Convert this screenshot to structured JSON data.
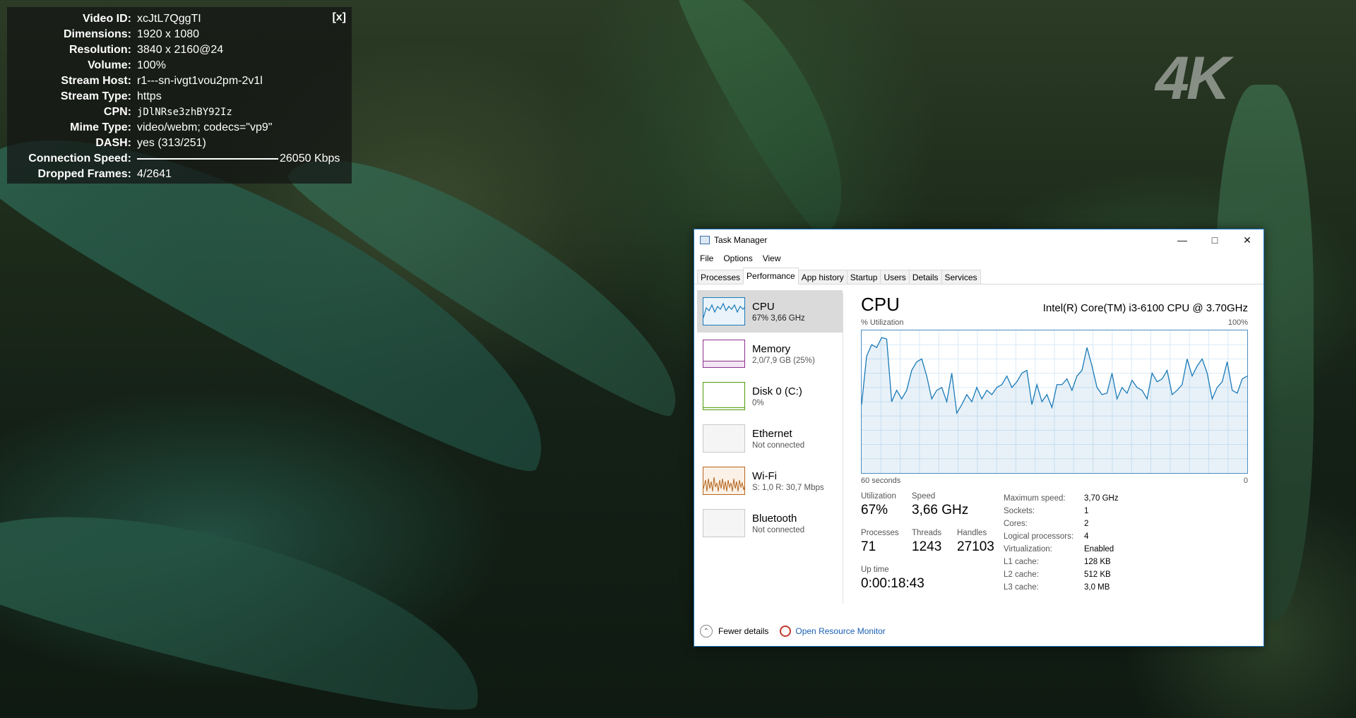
{
  "overlay": {
    "close_label": "[x]",
    "rows": [
      {
        "key": "Video ID:",
        "value": "xcJtL7QggTI"
      },
      {
        "key": "Dimensions:",
        "value": "1920 x 1080"
      },
      {
        "key": "Resolution:",
        "value": "3840 x 2160@24"
      },
      {
        "key": "Volume:",
        "value": "100%"
      },
      {
        "key": "Stream Host:",
        "value": "r1---sn-ivgt1vou2pm-2v1l"
      },
      {
        "key": "Stream Type:",
        "value": "https"
      },
      {
        "key": "CPN:",
        "value": "jDlNRse3zhBY92Iz"
      },
      {
        "key": "Mime Type:",
        "value": "video/webm; codecs=\"vp9\""
      },
      {
        "key": "DASH:",
        "value": "yes (313/251)"
      },
      {
        "key": "Connection Speed:",
        "value": "26050 Kbps"
      },
      {
        "key": "Dropped Frames:",
        "value": "4/2641"
      }
    ]
  },
  "watermark": "4K",
  "taskmanager": {
    "title": "Task Manager",
    "menu": [
      "File",
      "Options",
      "View"
    ],
    "tabs": [
      "Processes",
      "Performance",
      "App history",
      "Startup",
      "Users",
      "Details",
      "Services"
    ],
    "active_tab": "Performance",
    "resources": [
      {
        "name": "CPU",
        "sub": "67% 3,66 GHz",
        "color": "#1a7ab8"
      },
      {
        "name": "Memory",
        "sub": "2,0/7,9 GB (25%)",
        "color": "#8b2f8b"
      },
      {
        "name": "Disk 0 (C:)",
        "sub": "0%",
        "color": "#4e9a06"
      },
      {
        "name": "Ethernet",
        "sub": "Not connected",
        "color": "#a0a0a0"
      },
      {
        "name": "Wi-Fi",
        "sub": "S: 1,0 R: 30,7 Mbps",
        "color": "#b5651d"
      },
      {
        "name": "Bluetooth",
        "sub": "Not connected",
        "color": "#a0a0a0"
      }
    ],
    "cpu": {
      "heading": "CPU",
      "model": "Intel(R) Core(TM) i3-6100 CPU @ 3.70GHz",
      "util_label": "% Utilization",
      "max_label": "100%",
      "time_label": "60 seconds",
      "zero_label": "0",
      "utilization_label": "Utilization",
      "utilization": "67%",
      "speed_label": "Speed",
      "speed": "3,66 GHz",
      "processes_label": "Processes",
      "processes": "71",
      "threads_label": "Threads",
      "threads": "1243",
      "handles_label": "Handles",
      "handles": "27103",
      "uptime_label": "Up time",
      "uptime": "0:00:18:43",
      "specs": [
        {
          "k": "Maximum speed:",
          "v": "3,70 GHz"
        },
        {
          "k": "Sockets:",
          "v": "1"
        },
        {
          "k": "Cores:",
          "v": "2"
        },
        {
          "k": "Logical processors:",
          "v": "4"
        },
        {
          "k": "Virtualization:",
          "v": "Enabled"
        },
        {
          "k": "L1 cache:",
          "v": "128 KB"
        },
        {
          "k": "L2 cache:",
          "v": "512 KB"
        },
        {
          "k": "L3 cache:",
          "v": "3,0 MB"
        }
      ],
      "graph_values": [
        48,
        82,
        90,
        88,
        95,
        94,
        50,
        58,
        52,
        58,
        72,
        78,
        80,
        68,
        52,
        58,
        60,
        50,
        70,
        42,
        48,
        55,
        50,
        60,
        52,
        58,
        55,
        60,
        62,
        68,
        60,
        64,
        70,
        72,
        48,
        62,
        50,
        55,
        46,
        62,
        62,
        66,
        58,
        68,
        72,
        88,
        75,
        60,
        55,
        56,
        70,
        52,
        60,
        56,
        65,
        60,
        58,
        52,
        70,
        64,
        66,
        72,
        55,
        58,
        62,
        80,
        68,
        75,
        80,
        70,
        52,
        60,
        64,
        78,
        58,
        56,
        66,
        68
      ],
      "graph_color": "#1a7ab8"
    },
    "footer": {
      "fewer": "Fewer details",
      "resmon": "Open Resource Monitor"
    }
  }
}
